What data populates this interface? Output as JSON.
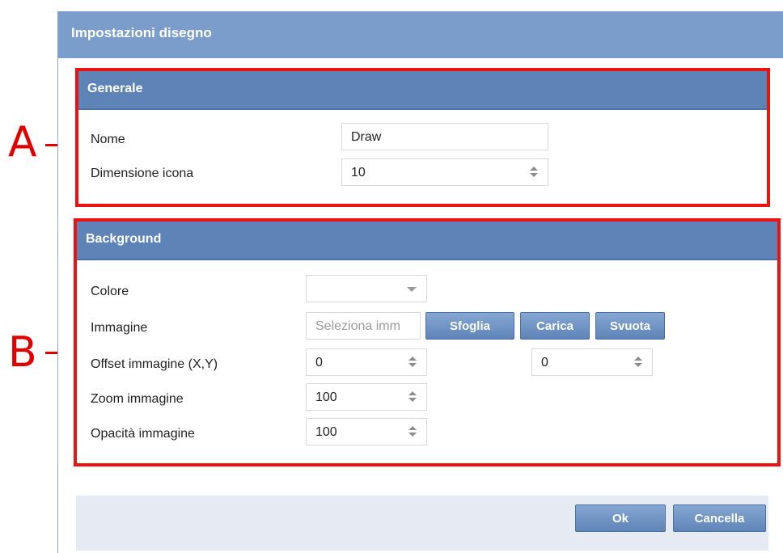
{
  "annotations": {
    "a": "A",
    "b": "B"
  },
  "dialog": {
    "title": "Impostazioni disegno"
  },
  "general": {
    "title": "Generale",
    "name_label": "Nome",
    "name_value": "Draw",
    "icon_size_label": "Dimensione icona",
    "icon_size_value": "10"
  },
  "background": {
    "title": "Background",
    "color_label": "Colore",
    "color_value": "",
    "image_label": "Immagine",
    "image_placeholder": "Seleziona imm",
    "browse_label": "Sfoglia",
    "upload_label": "Carica",
    "clear_label": "Svuota",
    "offset_label": "Offset immagine (X,Y)",
    "offset_x": "0",
    "offset_y": "0",
    "zoom_label": "Zoom immagine",
    "zoom_value": "100",
    "opacity_label": "Opacità immagine",
    "opacity_value": "100"
  },
  "footer": {
    "ok_label": "Ok",
    "cancel_label": "Cancella"
  },
  "colors": {
    "titlebar": "#7b9dcb",
    "panel_header": "#5e84b7",
    "annotation_red": "#e00000",
    "footer_bg": "#e6ebf3"
  }
}
